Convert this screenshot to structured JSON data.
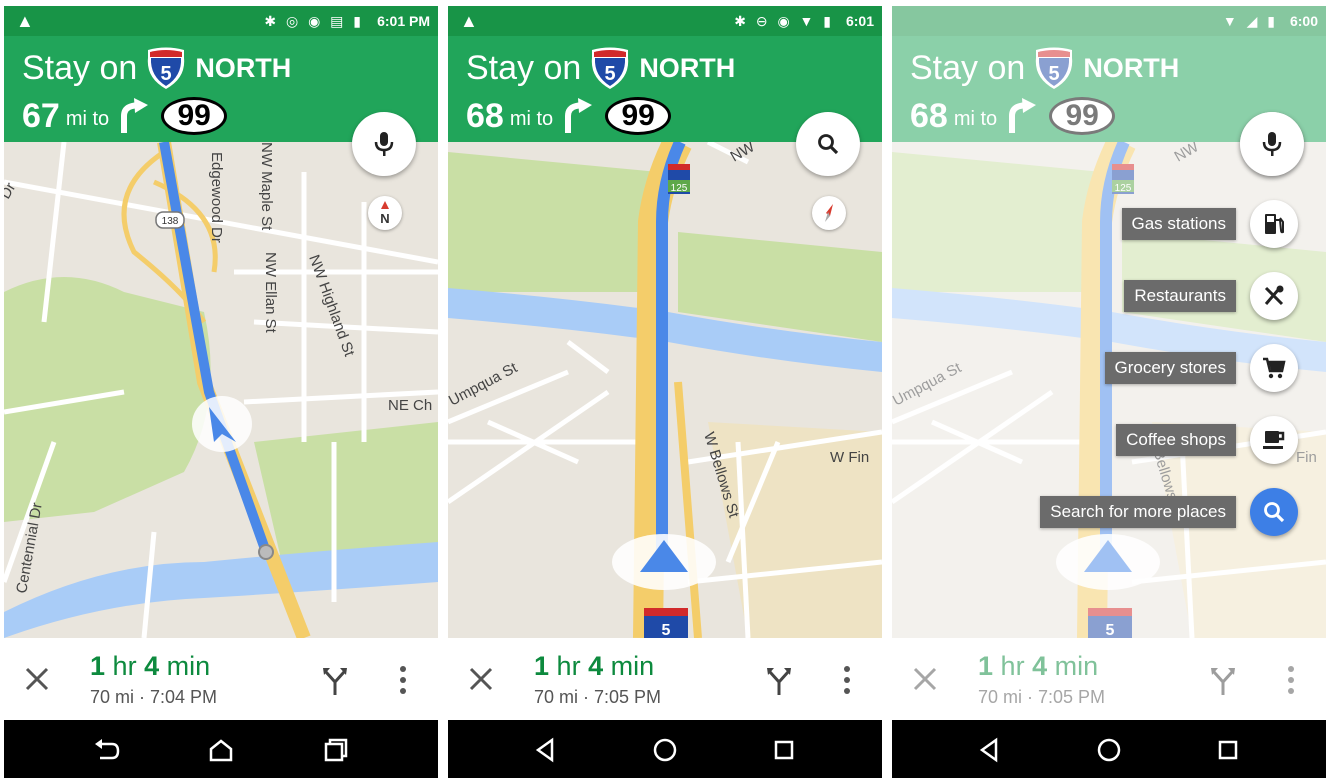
{
  "screens": [
    {
      "status": {
        "time": "6:01 PM",
        "icons": "✱ ◎ ◉ ▤ ▮"
      },
      "instruction": {
        "prefix": "Stay on",
        "highway": "5",
        "direction": "NORTH"
      },
      "distance": {
        "value": "67",
        "unit": "mi to",
        "route": "99"
      },
      "fab_icon": "microphone-icon",
      "compass_label": "N",
      "map_labels": {
        "road_a": "Edgewood Dr",
        "road_b": "NW Maple St",
        "road_c": "NW Ellan St",
        "road_d": "NW Highland St",
        "road_e": "NE Ch",
        "road_f": "Centennial Dr",
        "road_g": "Dr",
        "route_shield": "138"
      },
      "eta": {
        "hr": "1",
        "hr_unit": "hr",
        "min": "4",
        "min_unit": "min",
        "distance": "70 mi",
        "arrival": "7:04 PM"
      }
    },
    {
      "status": {
        "time": "6:01",
        "icons": "✱ ⊖ ◉ ▼ ▮"
      },
      "instruction": {
        "prefix": "Stay on",
        "highway": "5",
        "direction": "NORTH"
      },
      "distance": {
        "value": "68",
        "unit": "mi to",
        "route": "99"
      },
      "fab_icon": "search-icon",
      "map_labels": {
        "road_a": "Umpqua St",
        "road_b": "W Bellows St",
        "road_c": "W Fin",
        "road_d": "NW",
        "exit": "125",
        "highway": "5"
      },
      "eta": {
        "hr": "1",
        "hr_unit": "hr",
        "min": "4",
        "min_unit": "min",
        "distance": "70 mi",
        "arrival": "7:05 PM"
      }
    },
    {
      "status": {
        "time": "6:00",
        "icons": "▼ ◢ ▮"
      },
      "instruction": {
        "prefix": "Stay on",
        "highway": "5",
        "direction": "NORTH"
      },
      "distance": {
        "value": "68",
        "unit": "mi to",
        "route": "99"
      },
      "fab_icon": "microphone-icon",
      "map_labels": {
        "road_a": "Umpqua St",
        "road_b": "W Bellows St",
        "road_c": "Fin",
        "road_d": "NW",
        "exit": "125",
        "highway": "5"
      },
      "search_menu": [
        {
          "label": "Gas stations",
          "icon": "gas-station-icon"
        },
        {
          "label": "Restaurants",
          "icon": "restaurant-icon"
        },
        {
          "label": "Grocery stores",
          "icon": "shopping-cart-icon"
        },
        {
          "label": "Coffee shops",
          "icon": "coffee-cup-icon"
        },
        {
          "label": "Search for more places",
          "icon": "search-icon"
        }
      ],
      "eta": {
        "hr": "1",
        "hr_unit": "hr",
        "min": "4",
        "min_unit": "min",
        "distance": "70 mi",
        "arrival": "7:05 PM"
      }
    }
  ],
  "colors": {
    "banner": "#21a55a",
    "status_bar": "#189447",
    "route_blue": "#4a88e8",
    "highway_yellow": "#f4cd6a",
    "eta_green": "#0d8a3e",
    "river": "#a9ccf7",
    "park": "#c9dfa5"
  }
}
